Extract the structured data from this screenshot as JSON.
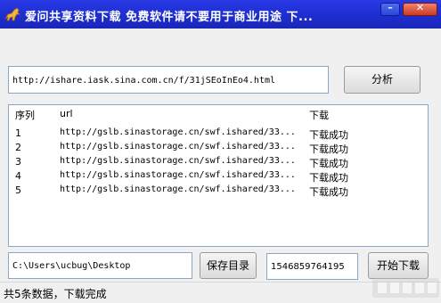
{
  "window": {
    "title": "爱问共享资料下载 免费软件请不要用于商业用途 下...",
    "minimize_label": "–",
    "close_label": "✕"
  },
  "url_field": {
    "value": "http://ishare.iask.sina.com.cn/f/31jSEoInEo4.html"
  },
  "analyze_label": "分析",
  "list": {
    "columns": [
      "序列",
      "url",
      "下载"
    ],
    "rows": [
      {
        "index": "1",
        "url": "http://gslb.sinastorage.cn/swf.ishared/33...",
        "status": "下载成功"
      },
      {
        "index": "2",
        "url": "http://gslb.sinastorage.cn/swf.ishared/33...",
        "status": "下载成功"
      },
      {
        "index": "3",
        "url": "http://gslb.sinastorage.cn/swf.ishared/33...",
        "status": "下载成功"
      },
      {
        "index": "4",
        "url": "http://gslb.sinastorage.cn/swf.ishared/33...",
        "status": "下载成功"
      },
      {
        "index": "5",
        "url": "http://gslb.sinastorage.cn/swf.ishared/33...",
        "status": "下载成功"
      }
    ]
  },
  "save_path": {
    "value": "C:\\Users\\ucbug\\Desktop"
  },
  "save_dir_label": "保存目录",
  "count_field": {
    "value": "1546859764195"
  },
  "start_label": "开始下载",
  "status": {
    "text": "共5条数据，下载完成"
  },
  "colors": {
    "titlebar": "#1f2fd4",
    "title_text": "#ffffff",
    "border": "#8aa6c8"
  },
  "icons": {
    "app": "horse-icon",
    "watermark": "watermark-logo"
  }
}
